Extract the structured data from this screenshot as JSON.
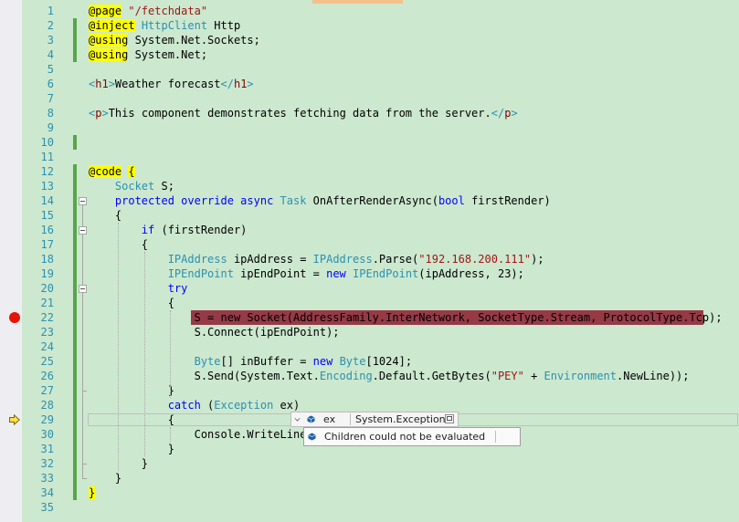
{
  "colors": {
    "editor_background": "#cce8cf",
    "keyword": "#0000ff",
    "type": "#2b91af",
    "string": "#a31515",
    "breakpoint_highlight": "#963a46",
    "razor_directive_highlight": "#ffff00"
  },
  "icons": {
    "breakpoint": "breakpoint-dot-icon",
    "execution": "current-statement-arrow-icon",
    "datatip_object": "cube-icon",
    "datatip_inspect": "magnifier-icon"
  },
  "editor": {
    "lines": [
      [
        {
          "t": "@page",
          "c": "hl-yellow plain"
        },
        {
          "t": " ",
          "c": "plain"
        },
        {
          "t": "\"/fetchdata\"",
          "c": "str"
        }
      ],
      [
        {
          "t": "@inject",
          "c": "hl-yellow plain"
        },
        {
          "t": " ",
          "c": "plain"
        },
        {
          "t": "HttpClient",
          "c": "ty"
        },
        {
          "t": " Http",
          "c": "plain"
        }
      ],
      [
        {
          "t": "@using",
          "c": "hl-yellow plain"
        },
        {
          "t": " System.Net.Sockets;",
          "c": "plain"
        }
      ],
      [
        {
          "t": "@using",
          "c": "hl-yellow plain"
        },
        {
          "t": " System.Net;",
          "c": "plain"
        }
      ],
      [],
      [
        {
          "t": "<",
          "c": "ty"
        },
        {
          "t": "h1",
          "c": "tag"
        },
        {
          "t": ">",
          "c": "ty"
        },
        {
          "t": "Weather forecast",
          "c": "plain"
        },
        {
          "t": "</",
          "c": "ty"
        },
        {
          "t": "h1",
          "c": "tag"
        },
        {
          "t": ">",
          "c": "ty"
        }
      ],
      [],
      [
        {
          "t": "<",
          "c": "ty"
        },
        {
          "t": "p",
          "c": "tag"
        },
        {
          "t": ">",
          "c": "ty"
        },
        {
          "t": "This component demonstrates fetching data from the server.",
          "c": "plain"
        },
        {
          "t": "</",
          "c": "ty"
        },
        {
          "t": "p",
          "c": "tag"
        },
        {
          "t": ">",
          "c": "ty"
        }
      ],
      [],
      [],
      [],
      [
        {
          "t": "@code",
          "c": "hl-yellow plain"
        },
        {
          "t": " ",
          "c": "plain"
        },
        {
          "t": "{",
          "c": "hl-yellow plain"
        }
      ],
      [
        {
          "t": "    ",
          "c": "plain"
        },
        {
          "t": "Socket",
          "c": "ty"
        },
        {
          "t": " S;",
          "c": "plain"
        }
      ],
      [
        {
          "t": "    ",
          "c": "plain"
        },
        {
          "t": "protected override async",
          "c": "kw"
        },
        {
          "t": " ",
          "c": "plain"
        },
        {
          "t": "Task",
          "c": "ty"
        },
        {
          "t": " OnAfterRenderAsync(",
          "c": "plain"
        },
        {
          "t": "bool",
          "c": "kw"
        },
        {
          "t": " firstRender)",
          "c": "plain"
        }
      ],
      [
        {
          "t": "    {",
          "c": "plain"
        }
      ],
      [
        {
          "t": "        ",
          "c": "plain"
        },
        {
          "t": "if",
          "c": "kw"
        },
        {
          "t": " (firstRender)",
          "c": "plain"
        }
      ],
      [
        {
          "t": "        {",
          "c": "plain"
        }
      ],
      [
        {
          "t": "            ",
          "c": "plain"
        },
        {
          "t": "IPAddress",
          "c": "ty"
        },
        {
          "t": " ipAddress = ",
          "c": "plain"
        },
        {
          "t": "IPAddress",
          "c": "ty"
        },
        {
          "t": ".Parse(",
          "c": "plain"
        },
        {
          "t": "\"192.168.200.111\"",
          "c": "str"
        },
        {
          "t": ");",
          "c": "plain"
        }
      ],
      [
        {
          "t": "            ",
          "c": "plain"
        },
        {
          "t": "IPEndPoint",
          "c": "ty"
        },
        {
          "t": " ipEndPoint = ",
          "c": "plain"
        },
        {
          "t": "new",
          "c": "kw"
        },
        {
          "t": " ",
          "c": "plain"
        },
        {
          "t": "IPEndPoint",
          "c": "ty"
        },
        {
          "t": "(ipAddress, 23);",
          "c": "plain"
        }
      ],
      [
        {
          "t": "            ",
          "c": "plain"
        },
        {
          "t": "try",
          "c": "kw"
        }
      ],
      [
        {
          "t": "            {",
          "c": "plain"
        }
      ],
      [
        {
          "t": "                ",
          "c": "plain"
        },
        {
          "t": "S = new Socket(AddressFamily.InterNetwork, SocketType.Stream, ProtocolType.Tcp);",
          "c": "t"
        }
      ],
      [
        {
          "t": "                S.Connect(ipEndPoint);",
          "c": "plain"
        }
      ],
      [],
      [
        {
          "t": "                ",
          "c": "plain"
        },
        {
          "t": "Byte",
          "c": "ty"
        },
        {
          "t": "[] inBuffer = ",
          "c": "plain"
        },
        {
          "t": "new",
          "c": "kw"
        },
        {
          "t": " ",
          "c": "plain"
        },
        {
          "t": "Byte",
          "c": "ty"
        },
        {
          "t": "[1024];",
          "c": "plain"
        }
      ],
      [
        {
          "t": "                S.Send(System.Text.",
          "c": "plain"
        },
        {
          "t": "Encoding",
          "c": "ty"
        },
        {
          "t": ".Default.GetBytes(",
          "c": "plain"
        },
        {
          "t": "\"PEY\"",
          "c": "str"
        },
        {
          "t": " + ",
          "c": "plain"
        },
        {
          "t": "Environment",
          "c": "ty"
        },
        {
          "t": ".NewLine));",
          "c": "plain"
        }
      ],
      [
        {
          "t": "            }",
          "c": "plain"
        }
      ],
      [
        {
          "t": "            ",
          "c": "plain"
        },
        {
          "t": "catch",
          "c": "kw"
        },
        {
          "t": " (",
          "c": "plain"
        },
        {
          "t": "Exception",
          "c": "ty"
        },
        {
          "t": " ex)",
          "c": "plain"
        }
      ],
      [
        {
          "t": "            {",
          "c": "plain"
        }
      ],
      [
        {
          "t": "                Console.WriteLine(",
          "c": "plain"
        }
      ],
      [
        {
          "t": "            }",
          "c": "plain"
        }
      ],
      [
        {
          "t": "        }",
          "c": "plain"
        }
      ],
      [
        {
          "t": "    }",
          "c": "plain"
        }
      ],
      [
        {
          "t": "}",
          "c": "hl-yellow plain"
        }
      ],
      []
    ]
  },
  "datatip": {
    "name": "ex",
    "value": "System.Exception",
    "child_message": "Children could not be evaluated"
  }
}
